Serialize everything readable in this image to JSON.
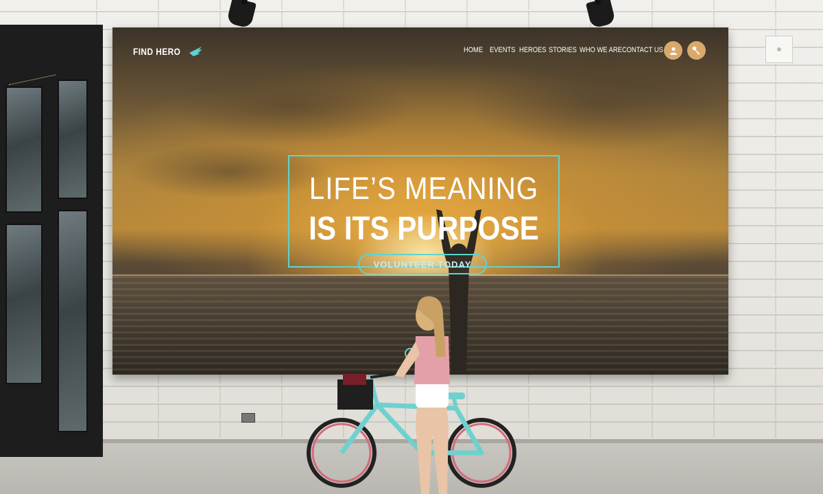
{
  "site": {
    "logo_text": "FIND HERO",
    "nav": [
      "HOME",
      "EVENTS",
      "HEROES",
      "STORIES",
      "WHO WE ARE",
      "CONTACT US"
    ],
    "actions": {
      "user_icon": "user-icon",
      "login_icon": "key-icon"
    }
  },
  "hero": {
    "line1": "LIFE’S MEANING",
    "line2": "IS ITS PURPOSE",
    "cta": "VOLUNTEER TODAY"
  },
  "colors": {
    "accent": "#5fd3cf",
    "icon_button": "#d8a96b",
    "text": "#ffffff"
  }
}
